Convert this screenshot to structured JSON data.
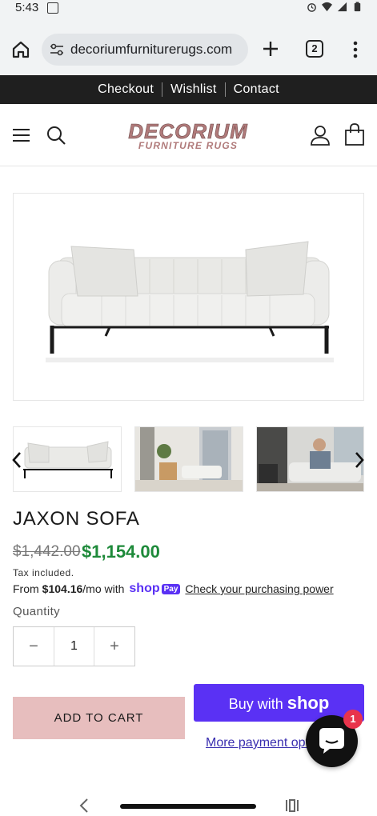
{
  "status_bar": {
    "time": "5:43"
  },
  "browser": {
    "url": "decoriumfurniturerugs.com",
    "tab_count": "2"
  },
  "top_links": [
    "Checkout",
    "Wishlist",
    "Contact"
  ],
  "logo": {
    "line1": "DECORIUM",
    "line2": "FURNITURE RUGS",
    "color": "#b07a7a"
  },
  "product": {
    "title": "JAXON SOFA",
    "price_original": "$1,442.00",
    "price_sale": "$1,154.00",
    "tax_note": "Tax included.",
    "installment_prefix": "From",
    "installment_amount": "$104.16",
    "installment_suffix": "/mo with",
    "shop_pay_word": "shop",
    "shop_pay_badge": "Pay",
    "installment_link": "Check your purchasing power",
    "quantity_label": "Quantity",
    "quantity_value": "1",
    "qty_minus": "−",
    "qty_plus": "+"
  },
  "actions": {
    "add_to_cart": "ADD TO CART",
    "buy_now_prefix": "Buy with",
    "buy_now_brand": "shop",
    "more_payment": "More payment options"
  },
  "chat": {
    "badge_count": "1"
  },
  "colors": {
    "accent_pink": "#e7bebe",
    "shop_purple": "#5a31f4",
    "sale_green": "#1e8a3a",
    "badge_red": "#e8344c"
  }
}
